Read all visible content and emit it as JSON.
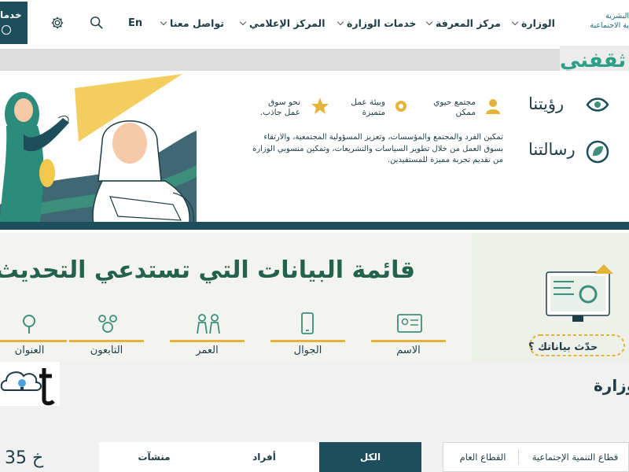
{
  "header": {
    "services_button": "خدمات",
    "language": "En",
    "nav": [
      {
        "label": "الوزارة",
        "has_dropdown": true
      },
      {
        "label": "مركز المعرفة",
        "has_dropdown": true
      },
      {
        "label": "خدمات الوزارة",
        "has_dropdown": true
      },
      {
        "label": "المركز الإعلامي",
        "has_dropdown": true
      },
      {
        "label": "تواصل معنا",
        "has_dropdown": true
      }
    ],
    "logo_lines": [
      "البشرية",
      "ية الاجتماعية"
    ],
    "icons": [
      "gear-icon",
      "search-icon",
      "phone-icon"
    ]
  },
  "brand_fragment": "ثقفني",
  "banner": {
    "vision_title": "رؤيتنا",
    "mission_title": "رسالتنا",
    "features": [
      {
        "text": "مجتمع حيوي ممكن",
        "icon": "person-icon"
      },
      {
        "text": "وبيئة عمل متميزة",
        "icon": "gear-icon"
      },
      {
        "text": "نحو سوق عمل جاذب.",
        "icon": "star-icon"
      }
    ],
    "mission_text": "تمكين الفرد والمجتمع والمؤسسات، وتعزيز المسؤولية المجتمعية، والارتقاء بسوق العمل من خلال تطوير السياسات والتشريعات، وتمكين منسوبي الوزارة من تقديم تجربة مميزة للمستفيدين."
  },
  "update_section": {
    "title": "قائمة البيانات التي تستدعي التحديث",
    "fields": [
      {
        "label": "الاسم",
        "icon": "id-card-icon"
      },
      {
        "label": "الجوال",
        "icon": "mobile-icon"
      },
      {
        "label": "العمر",
        "icon": "family-icon"
      },
      {
        "label": "التابعون",
        "icon": "dependents-icon"
      },
      {
        "label": "العنوان",
        "icon": "location-icon"
      }
    ],
    "side_question": "حدّث بياناتك ؟"
  },
  "bottom": {
    "section_title": "وزارة",
    "count": "35 خ",
    "tabs": [
      {
        "label": "الكل",
        "active": true
      },
      {
        "label": "أفراد",
        "active": false
      },
      {
        "label": "منشآت",
        "active": false
      }
    ],
    "sectors": [
      "القطاع العام",
      "قطاع التنمية الإجتماعية"
    ]
  },
  "colors": {
    "primary": "#1d4e5c",
    "accent_gold": "#e4b43a",
    "green": "#23624c",
    "brand_green": "#2d9f86"
  }
}
